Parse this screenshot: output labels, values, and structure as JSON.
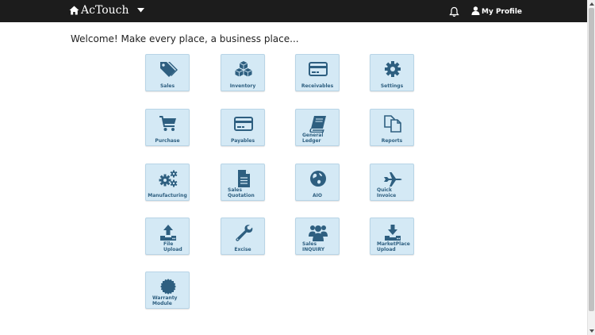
{
  "navbar": {
    "brand": "AcTouch",
    "profile_label": "My Profile",
    "bg_color": "#1c1c1c"
  },
  "welcome": "Welcome! Make every place, a business place...",
  "tiles": [
    {
      "label": "Sales",
      "icon": "tags-icon"
    },
    {
      "label": "Inventory",
      "icon": "cubes-icon"
    },
    {
      "label": "Receivables",
      "icon": "credit-card-icon"
    },
    {
      "label": "Settings",
      "icon": "gear-icon"
    },
    {
      "label": "Purchase",
      "icon": "shopping-cart-icon"
    },
    {
      "label": "Payables",
      "icon": "credit-card-icon"
    },
    {
      "label": "General\nLedger",
      "icon": "book-icon"
    },
    {
      "label": "Reports",
      "icon": "copy-icon"
    },
    {
      "label": "Manufacturing",
      "icon": "gears-icon"
    },
    {
      "label": "Sales\nQuotation",
      "icon": "file-text-icon"
    },
    {
      "label": "AIO",
      "icon": "globe-icon"
    },
    {
      "label": "Quick\nInvoice",
      "icon": "plane-icon"
    },
    {
      "label": "File\nUpload",
      "icon": "upload-icon"
    },
    {
      "label": "Excise",
      "icon": "wrench-icon"
    },
    {
      "label": "Sales\nINQUIRY",
      "icon": "users-icon"
    },
    {
      "label": "MarketPlace\nUpload",
      "icon": "download-icon"
    },
    {
      "label": "Warranty\nModule",
      "icon": "certificate-icon"
    }
  ],
  "colors": {
    "tile_bg": "#d4e9f5",
    "icon": "#2e5f80",
    "label": "#2e5f80"
  }
}
